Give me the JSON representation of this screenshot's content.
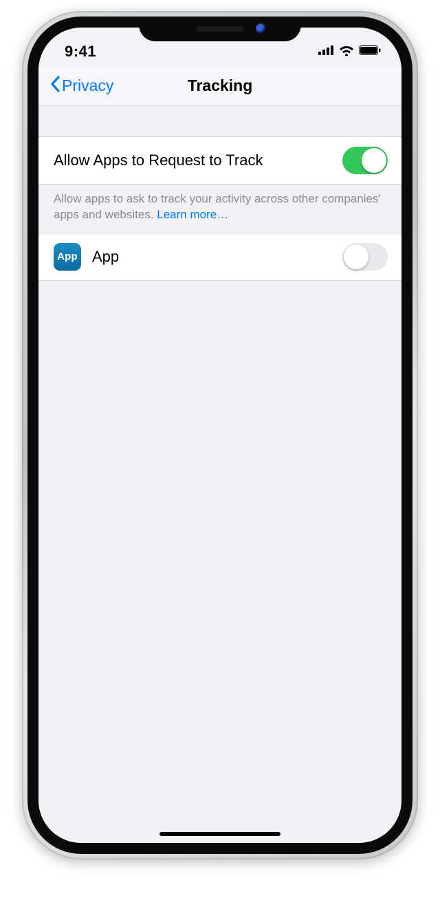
{
  "statusbar": {
    "time": "9:41"
  },
  "nav": {
    "back_label": "Privacy",
    "title": "Tracking"
  },
  "settings": {
    "allow_label": "Allow Apps to Request to Track",
    "allow_on": true,
    "footer": "Allow apps to ask to track your activity across other companies' apps and websites. ",
    "learn_more": "Learn more…"
  },
  "apps": [
    {
      "icon_text": "App",
      "name": "App",
      "on": false
    }
  ]
}
